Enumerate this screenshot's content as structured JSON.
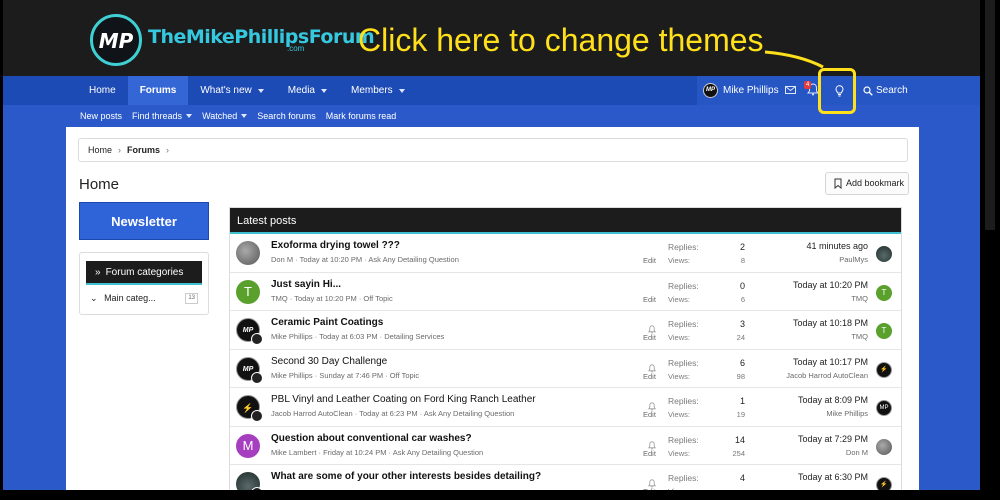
{
  "header": {
    "logo_initials": "MP",
    "site_name": "TheMikePhillipsForum",
    "site_tld": ".com",
    "annotation": "Click here to change themes"
  },
  "nav": {
    "tabs": [
      {
        "label": "Home",
        "active": false,
        "caret": false
      },
      {
        "label": "Forums",
        "active": true,
        "caret": false
      },
      {
        "label": "What's new",
        "active": false,
        "caret": true
      },
      {
        "label": "Media",
        "active": false,
        "caret": true
      },
      {
        "label": "Members",
        "active": false,
        "caret": true
      }
    ],
    "user_initials": "MP",
    "user_name": "Mike Phillips",
    "alert_count": "4",
    "search_label": "Search"
  },
  "subnav": {
    "items": [
      {
        "label": "New posts",
        "caret": false
      },
      {
        "label": "Find threads",
        "caret": true
      },
      {
        "label": "Watched",
        "caret": true
      },
      {
        "label": "Search forums",
        "caret": false
      },
      {
        "label": "Mark forums read",
        "caret": false
      }
    ]
  },
  "breadcrumb": {
    "home": "Home",
    "current": "Forums"
  },
  "page_title": "Home",
  "bookmark_label": "Add bookmark",
  "sidebar": {
    "newsletter": "Newsletter",
    "categories_header": "Forum categories",
    "main_category": "Main categ...",
    "main_category_count": "13"
  },
  "latest": {
    "header": "Latest posts",
    "replies_label": "Replies:",
    "views_label": "Views:",
    "edit_label": "Edit",
    "rows": [
      {
        "title": "Exoforma drying towel ???",
        "bold": true,
        "meta": "Don M · Today at 10:20 PM · Ask Any Detailing Question",
        "replies": "2",
        "views": "8",
        "time": "41 minutes ago",
        "last_user": "PaulMys",
        "avatar": "photo",
        "initial": "",
        "avatar_color": "#777777",
        "bell": false,
        "last_avatar": "car",
        "last_color": "#3a3a3a",
        "last_initial": ""
      },
      {
        "title": "Just sayin Hi...",
        "bold": true,
        "meta": "TMQ · Today at 10:20 PM · Off Topic",
        "replies": "0",
        "views": "6",
        "time": "Today at 10:20 PM",
        "last_user": "TMQ",
        "avatar": "letter",
        "initial": "T",
        "avatar_color": "#5aa02c",
        "bell": false,
        "last_avatar": "letter",
        "last_color": "#5aa02c",
        "last_initial": "T"
      },
      {
        "title": "Ceramic Paint Coatings",
        "bold": true,
        "meta": "Mike Phillips · Today at 6:03 PM · Detailing Services",
        "replies": "3",
        "views": "24",
        "time": "Today at 10:18 PM",
        "last_user": "TMQ",
        "avatar": "mp",
        "initial": "MP",
        "avatar_color": "#111111",
        "bell": true,
        "last_avatar": "letter",
        "last_color": "#5aa02c",
        "last_initial": "T"
      },
      {
        "title": "Second 30 Day Challenge",
        "bold": false,
        "meta": "Mike Phillips · Sunday at 7:46 PM · Off Topic",
        "replies": "6",
        "views": "98",
        "time": "Today at 10:17 PM",
        "last_user": "Jacob Harrod AutoClean",
        "avatar": "mp",
        "initial": "MP",
        "avatar_color": "#111111",
        "bell": true,
        "last_avatar": "dark",
        "last_color": "#111111",
        "last_initial": "⚡"
      },
      {
        "title": "PBL Vinyl and Leather Coating on Ford King Ranch Leather",
        "bold": false,
        "meta": "Jacob Harrod AutoClean · Today at 6:23 PM · Ask Any Detailing Question",
        "replies": "1",
        "views": "19",
        "time": "Today at 8:09 PM",
        "last_user": "Mike Phillips",
        "avatar": "dark",
        "initial": "⚡",
        "avatar_color": "#111111",
        "bell": true,
        "last_avatar": "mp",
        "last_color": "#111111",
        "last_initial": "MP"
      },
      {
        "title": "Question about conventional car washes?",
        "bold": true,
        "meta": "Mike Lambert · Friday at 10:24 PM · Ask Any Detailing Question",
        "replies": "14",
        "views": "254",
        "time": "Today at 7:29 PM",
        "last_user": "Don M",
        "avatar": "letter",
        "initial": "M",
        "avatar_color": "#a63fbf",
        "bell": true,
        "last_avatar": "photo",
        "last_color": "#777777",
        "last_initial": ""
      },
      {
        "title": "What are some of your other interests besides detailing?",
        "bold": true,
        "meta": "",
        "replies": "4",
        "views": "",
        "time": "Today at 6:30 PM",
        "last_user": "",
        "avatar": "car",
        "initial": "",
        "avatar_color": "#3a3a3a",
        "bell": true,
        "last_avatar": "dark",
        "last_color": "#111111",
        "last_initial": "⚡"
      }
    ]
  },
  "colors": {
    "header_bg": "#1c1c1c",
    "nav_bg": "#1d4bb5",
    "accent": "#3fc0d0",
    "annotation": "#ffe01a",
    "brand": "#36c8e0"
  }
}
